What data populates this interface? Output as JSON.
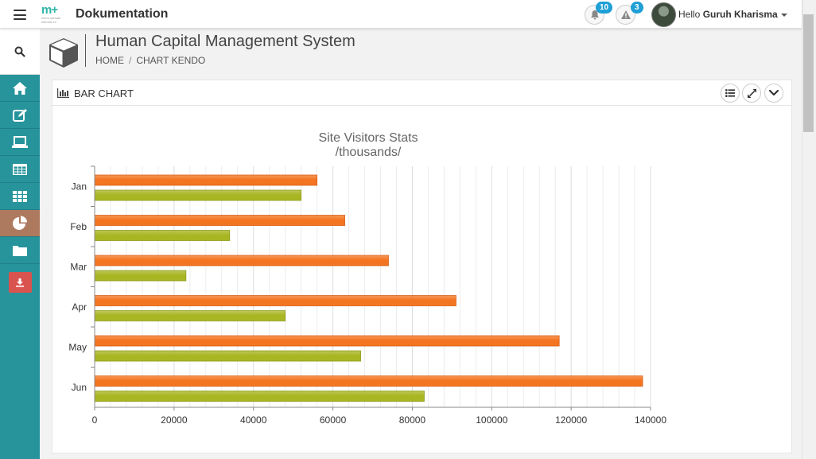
{
  "app": {
    "logo_text": "m+",
    "logo_tagline": "menu sebuah internet ini",
    "title": "Dokumentation"
  },
  "notifications": [
    {
      "icon": "bell-icon",
      "count": "10"
    },
    {
      "icon": "warning-icon",
      "count": "3"
    }
  ],
  "user": {
    "greeting": "Hello",
    "name": "Guruh Kharisma"
  },
  "sidebar": {
    "items": [
      {
        "icon": "search-icon"
      },
      {
        "icon": "home-icon"
      },
      {
        "icon": "edit-icon"
      },
      {
        "icon": "laptop-icon"
      },
      {
        "icon": "table-icon"
      },
      {
        "icon": "grid-icon"
      },
      {
        "icon": "pie-chart-icon",
        "active": true
      },
      {
        "icon": "folder-icon"
      },
      {
        "icon": "download-icon"
      }
    ]
  },
  "header": {
    "title": "Human Capital Management System",
    "breadcrumb": [
      "HOME",
      "CHART KENDO"
    ]
  },
  "panel": {
    "title": "BAR CHART",
    "tools": [
      "list-icon",
      "expand-icon",
      "collapse-icon"
    ]
  },
  "colors": {
    "sidebar": "#27949c",
    "sidebar_active": "#ae7a5f",
    "series_1": "#f47521",
    "series_2": "#a9b624",
    "badge": "#1e9fd6"
  },
  "chart_data": {
    "type": "bar",
    "orientation": "horizontal",
    "title": "Site Visitors Stats",
    "subtitle": "/thousands/",
    "categories": [
      "Jan",
      "Feb",
      "Mar",
      "Apr",
      "May",
      "Jun"
    ],
    "series": [
      {
        "color": "#f47521",
        "values": [
          56000,
          63000,
          74000,
          91000,
          117000,
          138000
        ]
      },
      {
        "color": "#a9b624",
        "values": [
          52000,
          34000,
          23000,
          48000,
          67000,
          83000
        ]
      }
    ],
    "xlim": [
      0,
      140000
    ],
    "xticks": [
      "0",
      "20000",
      "40000",
      "60000",
      "80000",
      "100000",
      "120000",
      "140000"
    ],
    "grid": true
  }
}
